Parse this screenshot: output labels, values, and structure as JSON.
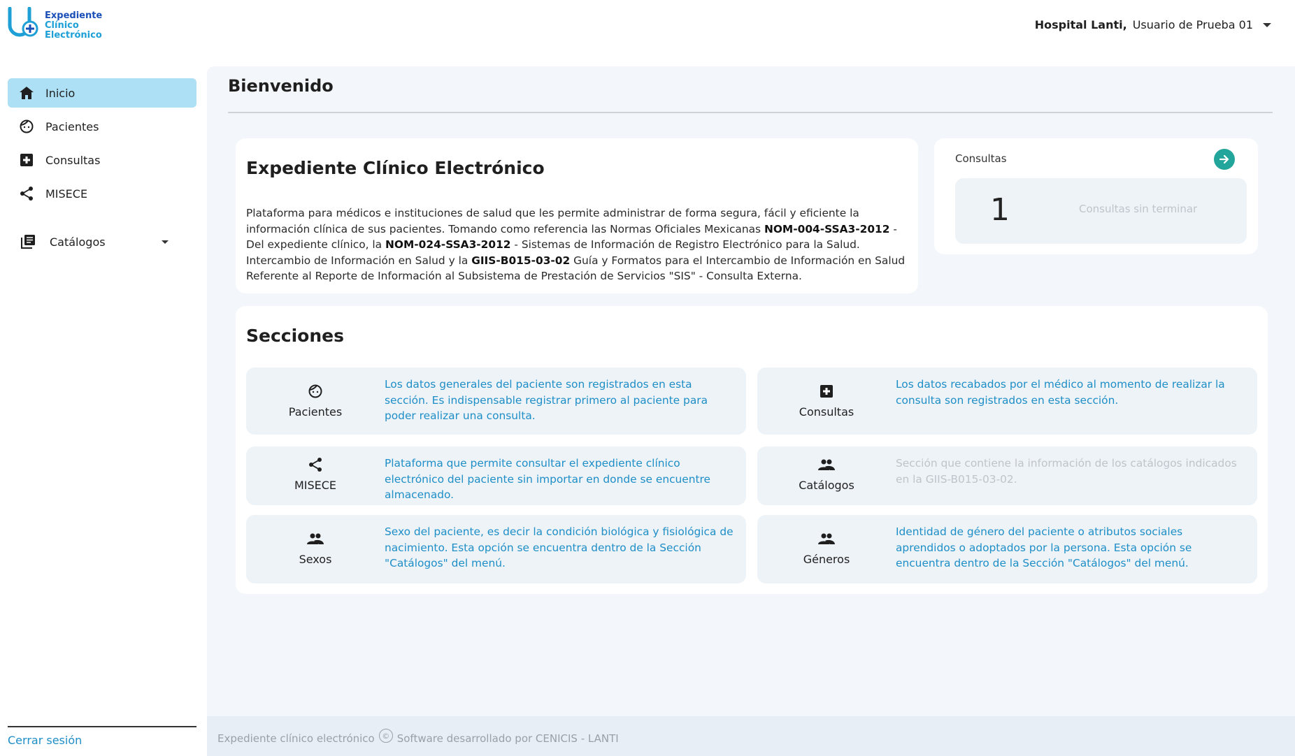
{
  "header": {
    "logo_lines": [
      "Expediente",
      "Clínico",
      "Electrónico"
    ],
    "hospital": "Hospital Lanti,",
    "user": "Usuario de Prueba 01"
  },
  "sidebar": {
    "items": [
      {
        "label": "Inicio",
        "icon": "home-icon",
        "active": true
      },
      {
        "label": "Pacientes",
        "icon": "face-icon"
      },
      {
        "label": "Consultas",
        "icon": "medical-cross-icon"
      },
      {
        "label": "MISECE",
        "icon": "share-icon"
      },
      {
        "label": "Catálogos",
        "icon": "library-books-icon"
      }
    ],
    "logout": "Cerrar sesión"
  },
  "main": {
    "title": "Bienvenido",
    "info": {
      "heading": "Expediente Clínico Electrónico",
      "p1": "Plataforma para médicos e instituciones de salud que les permite administrar de forma segura, fácil y eficiente la información clínica de sus pacientes. Tomando como referencia las Normas Oficiales Mexicanas ",
      "b1": "NOM-004-SSA3-2012",
      "p2": " - Del expediente clínico, la ",
      "b2": "NOM-024-SSA3-2012",
      "p3": " - Sistemas de Información de Registro Electrónico para la Salud. Intercambio de Información en Salud y la ",
      "b3": "GIIS-B015-03-02",
      "p4": " Guía y Formatos para el Intercambio de Información en Salud Referente al Reporte de Información al Subsistema de Prestación de Servicios \"SIS\" - Consulta Externa."
    },
    "consultas": {
      "label": "Consultas",
      "count": "1",
      "description": "Consultas sin terminar",
      "arrow_color": "#22a59a"
    },
    "sections": {
      "heading": "Secciones",
      "items": [
        {
          "label": "Pacientes",
          "icon": "face-icon",
          "description": "Los datos generales del paciente son registrados en esta sección. Es indispensable registrar primero al paciente para poder realizar una consulta."
        },
        {
          "label": "Consultas",
          "icon": "medical-cross-icon",
          "description": "Los datos recabados por el médico al momento de realizar la consulta son registrados en esta sección."
        },
        {
          "label": "MISECE",
          "icon": "share-icon",
          "description": "Plataforma que permite consultar el expediente clínico electrónico del paciente sin importar en donde se encuentre almacenado."
        },
        {
          "label": "Catálogos",
          "icon": "people-icon",
          "description": "Sección que contiene la información de los catálogos indicados en la GIIS-B015-03-02."
        },
        {
          "label": "Sexos",
          "icon": "people-icon",
          "description": "Sexo del paciente, es decir la condición biológica y fisiológica de nacimiento. Esta opción se encuentra dentro de la Sección \"Catálogos\" del menú."
        },
        {
          "label": "Géneros",
          "icon": "people-icon",
          "description": "Identidad de género del paciente o atributos sociales aprendidos o adoptados por la persona. Esta opción se encuentra dentro de la Sección \"Catálogos\" del menú."
        }
      ]
    }
  },
  "footer": {
    "left": "Expediente clínico electrónico",
    "copyright": "©",
    "right": "Software desarrollado por CENICIS - LANTI"
  },
  "colors": {
    "active_nav": "#aee0f5",
    "link_blue": "#1e8ec7",
    "brand_dark": "#1a4fb8",
    "brand_light": "#1ea0d6"
  }
}
